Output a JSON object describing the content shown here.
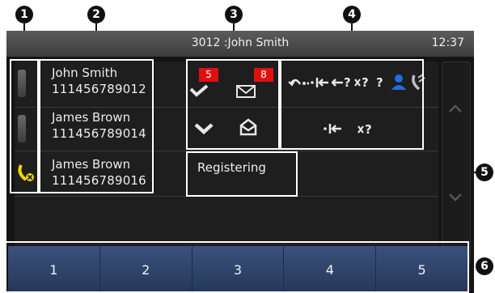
{
  "callouts": [
    "1",
    "2",
    "3",
    "4",
    "5",
    "6"
  ],
  "header": {
    "title": "3012 :John  Smith",
    "clock": "12:37"
  },
  "lines": [
    {
      "name": "John Smith",
      "number": "111456789012",
      "status_icon": "status-bar-icon"
    },
    {
      "name": "James Brown",
      "number": "111456789014",
      "status_icon": "status-bar-icon"
    },
    {
      "name": "James Brown",
      "number": "111456789016",
      "status_icon": "handset-disconnected-icon"
    }
  ],
  "message_indicators": {
    "row1": {
      "missed_calls": "5",
      "voicemail": "8"
    }
  },
  "registration_status": "Registering",
  "feature_icons": {
    "row1": [
      "call-forward-icon",
      "dnd-icon",
      "forward-icon",
      "unknown-icon",
      "unknown-icon",
      "contact-icon",
      "phone-icon"
    ],
    "row2": [
      "dnd-icon",
      "unknown-icon"
    ]
  },
  "softkeys": [
    "1",
    "2",
    "3",
    "4",
    "5"
  ],
  "colors": {
    "badge": "#e01010",
    "softkey": "#2b3e63",
    "contact_icon": "#1e6fe0",
    "handset_alert": "#f0d400"
  }
}
